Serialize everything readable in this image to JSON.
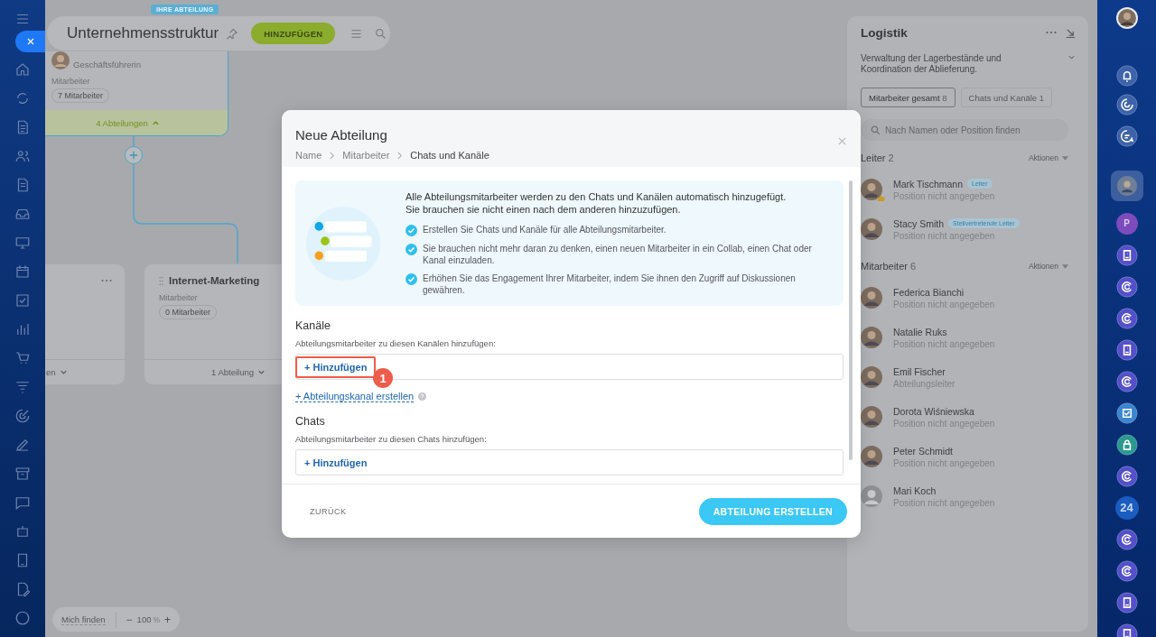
{
  "header": {
    "title": "Unternehmensstruktur",
    "add_button": "HINZUFÜGEN"
  },
  "org_chart": {
    "root": {
      "badge": "IHRE ABTEILUNG",
      "role": "Geschäftsführerin",
      "members_label": "Mitarbeiter",
      "members_count": "7 Mitarbeiter",
      "subdivisions": "4 Abteilungen",
      "expanded": true
    },
    "departments": [
      {
        "subdivisions": "en",
        "expanded": false
      },
      {
        "name": "Internet-Marketing",
        "members_label": "Mitarbeiter",
        "members_count": "0 Mitarbeiter",
        "subdivisions": "1 Abteilung",
        "expanded": false
      }
    ]
  },
  "zoom_bar": {
    "find_me": "Mich finden",
    "minus": "−",
    "value": "100",
    "unit": "%",
    "plus": "+"
  },
  "modal": {
    "title": "Neue Abteilung",
    "steps": [
      {
        "label": "Name",
        "selected": false
      },
      {
        "label": "Mitarbeiter",
        "selected": false
      },
      {
        "label": "Chats und Kanäle",
        "selected": true
      }
    ],
    "intro": [
      "Alle Abteilungsmitarbeiter werden zu den Chats und Kanälen automatisch hinzugefügt.",
      "Sie brauchen sie nicht einen nach dem anderen hinzuzufügen."
    ],
    "points": [
      "Erstellen Sie Chats und Kanäle für alle Abteilungsmitarbeiter.",
      "Sie brauchen nicht mehr daran zu denken, einen neuen Mitarbeiter in ein Collab, einen Chat oder Kanal einzuladen.",
      "Erhöhen Sie das Engagement Ihrer Mitarbeiter, indem Sie ihnen den Zugriff auf Diskussionen gewähren."
    ],
    "sections": [
      {
        "title": "Kanäle",
        "hint": "Abteilungsmitarbeiter zu diesen Kanälen hinzufügen:",
        "add_label": "+ Hinzufügen",
        "highlighted": true,
        "step": "1",
        "create_link": "+ Abteilungskanal erstellen"
      },
      {
        "title": "Chats",
        "hint": "Abteilungsmitarbeiter zu diesen Chats hinzufügen:",
        "add_label": "+ Hinzufügen",
        "highlighted": false
      }
    ],
    "back": "ZURÜCK",
    "submit": "ABTEILUNG ERSTELLEN"
  },
  "side_panel": {
    "title": "Logistik",
    "description": "Verwaltung der Lagerbestände und Koordination der Ablieferung.",
    "tabs": [
      {
        "label": "Mitarbeiter gesamt",
        "count": "8",
        "selected": true
      },
      {
        "label": "Chats und Kanäle",
        "count": "1",
        "selected": false
      }
    ],
    "search": {
      "placeholder": "Nach Namen oder Position finden"
    },
    "groups": [
      {
        "title": "Leiter",
        "count": "2",
        "actions": "Aktionen",
        "people": [
          {
            "name": "Mark Tischmann",
            "badge": "Leiter",
            "position": "Position nicht angegeben",
            "photo": true,
            "crown": true
          },
          {
            "name": "Stacy Smith",
            "badge": "Stellvertretende Leiter",
            "position": "Position nicht angegeben",
            "photo": true,
            "crown": false
          }
        ]
      },
      {
        "title": "Mitarbeiter",
        "count": "6",
        "actions": "Aktionen",
        "people": [
          {
            "name": "Federica Bianchi",
            "position": "Position nicht angegeben",
            "photo": true,
            "crown": false
          },
          {
            "name": "Natalie Ruks",
            "position": "Position nicht angegeben",
            "photo": true,
            "crown": false
          },
          {
            "name": "Emil Fischer",
            "position": "Abteilungsleiter",
            "photo": true,
            "crown": false
          },
          {
            "name": "Dorota Wiśniewska",
            "position": "Position nicht angegeben",
            "photo": true,
            "crown": false
          },
          {
            "name": "Peter Schmidt",
            "position": "Position nicht angegeben",
            "photo": true,
            "crown": false
          },
          {
            "name": "Mari Koch",
            "position": "Position nicht angegeben",
            "photo": false,
            "crown": false
          }
        ]
      }
    ]
  },
  "right_rail": [
    {
      "kind": "avatar"
    },
    {
      "kind": "bell"
    },
    {
      "kind": "target"
    },
    {
      "kind": "chat"
    },
    {
      "kind": "avatar-tile"
    },
    {
      "kind": "letter",
      "text": "P",
      "color": "#7e4bbd"
    },
    {
      "kind": "contact"
    },
    {
      "kind": "spiral"
    },
    {
      "kind": "spiral"
    },
    {
      "kind": "contact"
    },
    {
      "kind": "spiral"
    },
    {
      "kind": "check"
    },
    {
      "kind": "lock"
    },
    {
      "kind": "spiral"
    },
    {
      "kind": "letter",
      "text": "24",
      "color": "#1b5cc0"
    },
    {
      "kind": "spiral"
    },
    {
      "kind": "spiral"
    },
    {
      "kind": "contact"
    },
    {
      "kind": "contact"
    }
  ]
}
